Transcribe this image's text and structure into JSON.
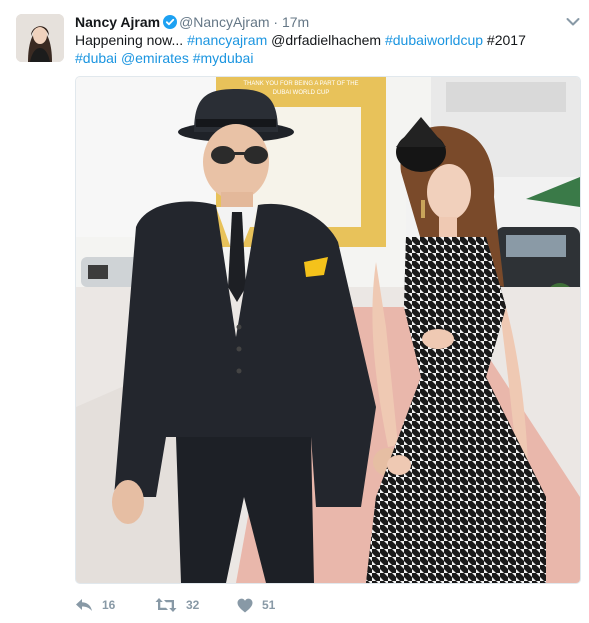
{
  "tweet": {
    "author": {
      "name": "Nancy Ajram",
      "handle": "@NancyAjram",
      "verified": true,
      "avatar_icon": "profile-photo"
    },
    "dot": "·",
    "time": "17m",
    "text_parts": [
      {
        "t": "Happening now... ",
        "link": false
      },
      {
        "t": "#nancyajram",
        "link": true
      },
      {
        "t": " @drfadielhachem ",
        "link": false
      },
      {
        "t": "#dubaiworldcup",
        "link": true
      },
      {
        "t": " #2017",
        "link": false
      },
      {
        "t": "#dubai",
        "link": true
      },
      {
        "t": " ",
        "link": false
      },
      {
        "t": "@emirates",
        "link": true
      },
      {
        "t": " ",
        "link": false
      },
      {
        "t": "#mydubai",
        "link": true
      }
    ],
    "media": {
      "banner_text_1": "THANK YOU FOR BEING A PART OF THE",
      "banner_text_2": "DUBAI WORLD CUP"
    },
    "actions": {
      "reply_count": "16",
      "retweet_count": "32",
      "like_count": "51"
    },
    "colors": {
      "link": "#1b95e0",
      "secondary": "#657786",
      "action": "#8899a6",
      "verified": "#1da1f2"
    }
  }
}
